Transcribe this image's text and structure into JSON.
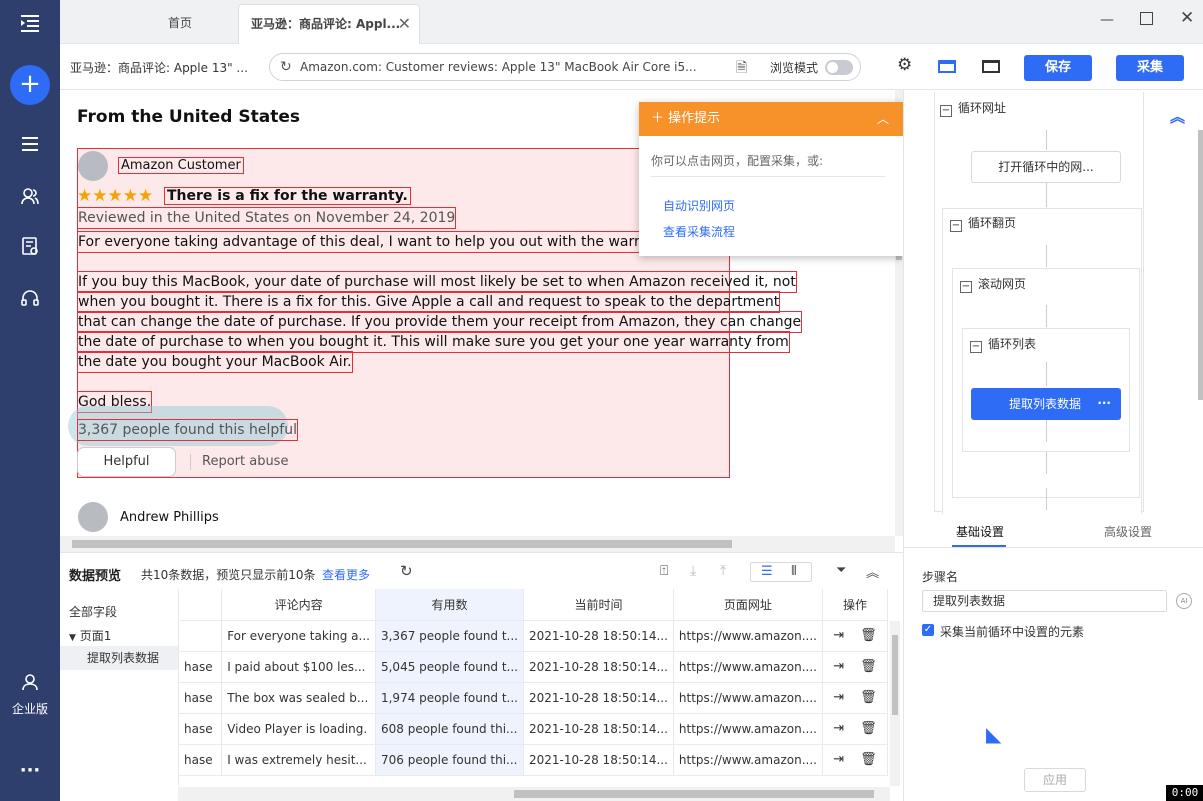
{
  "sidebar": {
    "enterprise_label": "企业版"
  },
  "tabs": [
    {
      "label": "首页"
    },
    {
      "label": "亚马逊：商品评论: Appl..."
    }
  ],
  "toolbar": {
    "page_title": "亚马逊：商品评论: Apple 13\" ...",
    "url": "Amazon.com: Customer reviews: Apple 13\" MacBook Air Core i5...",
    "browse_mode_label": "浏览模式",
    "save_label": "保存",
    "collect_label": "采集"
  },
  "page": {
    "heading": "From the United States",
    "review1": {
      "author": "Amazon Customer",
      "title": "There is a fix for the warranty.",
      "date": "Reviewed in the United States on November 24, 2019",
      "line1": "For everyone taking advantage of this deal, I want to help you out with the warranty situ",
      "line2": "If you buy this MacBook, your date of purchase will most likely be set to when Amazon received it, not",
      "line3": "when you bought it. There is a fix for this. Give Apple a call and request to speak to the department",
      "line4": "that can change the date of purchase. If you provide them your receipt from Amazon, they can change",
      "line5": "the date of purchase to when you bought it. This will make sure you get your one year warranty from",
      "line6": "the date you bought your MacBook Air.",
      "line7": "God bless.",
      "helpful_count": "3,367 people found this helpful",
      "helpful_btn": "Helpful",
      "report": "Report abuse"
    },
    "review2": {
      "author": "Andrew Phillips"
    }
  },
  "hint": {
    "title": "操作提示",
    "desc": "你可以点击网页，配置采集，或:",
    "link1": "自动识别网页",
    "link2": "查看采集流程"
  },
  "workflow": {
    "loop_url": "循环网址",
    "open_page": "打开循环中的网...",
    "loop_page": "循环翻页",
    "scroll": "滚动网页",
    "loop_list": "循环列表",
    "extract": "提取列表数据"
  },
  "settings": {
    "tab_basic": "基础设置",
    "tab_advanced": "高级设置",
    "step_name_label": "步骤名",
    "step_name_value": "提取列表数据",
    "checkbox_label": "采集当前循环中设置的元素",
    "apply": "应用"
  },
  "preview": {
    "title": "数据预览",
    "summary": "共10条数据，预览只显示前10条",
    "more": "查看更多",
    "tree_all": "全部字段",
    "tree_page": "页面1",
    "tree_item": "提取列表数据",
    "columns": [
      "评论内容",
      "有用数",
      "当前时间",
      "页面网址",
      "操作"
    ],
    "rows": [
      {
        "pre": "",
        "content": "For everyone taking a...",
        "helpful": "3,367 people found t...",
        "time": "2021-10-28 18:50:14...",
        "url": "https://www.amazon...."
      },
      {
        "pre": "hase",
        "content": "I paid about $100 les...",
        "helpful": "5,045 people found t...",
        "time": "2021-10-28 18:50:14...",
        "url": "https://www.amazon...."
      },
      {
        "pre": "hase",
        "content": "The box was sealed b...",
        "helpful": "1,974 people found t...",
        "time": "2021-10-28 18:50:14...",
        "url": "https://www.amazon...."
      },
      {
        "pre": "hase",
        "content": "Video Player is loading.",
        "helpful": "608 people found thi...",
        "time": "2021-10-28 18:50:14...",
        "url": "https://www.amazon...."
      },
      {
        "pre": "hase",
        "content": "I was extremely hesit...",
        "helpful": "706 people found thi...",
        "time": "2021-10-28 18:50:14...",
        "url": "https://www.amazon...."
      }
    ]
  },
  "timer": "0:00",
  "colors": {
    "rail": "#2e3f6d",
    "accent": "#2f6cf6",
    "hint": "#f7922b",
    "highlight": "#e2303b"
  }
}
